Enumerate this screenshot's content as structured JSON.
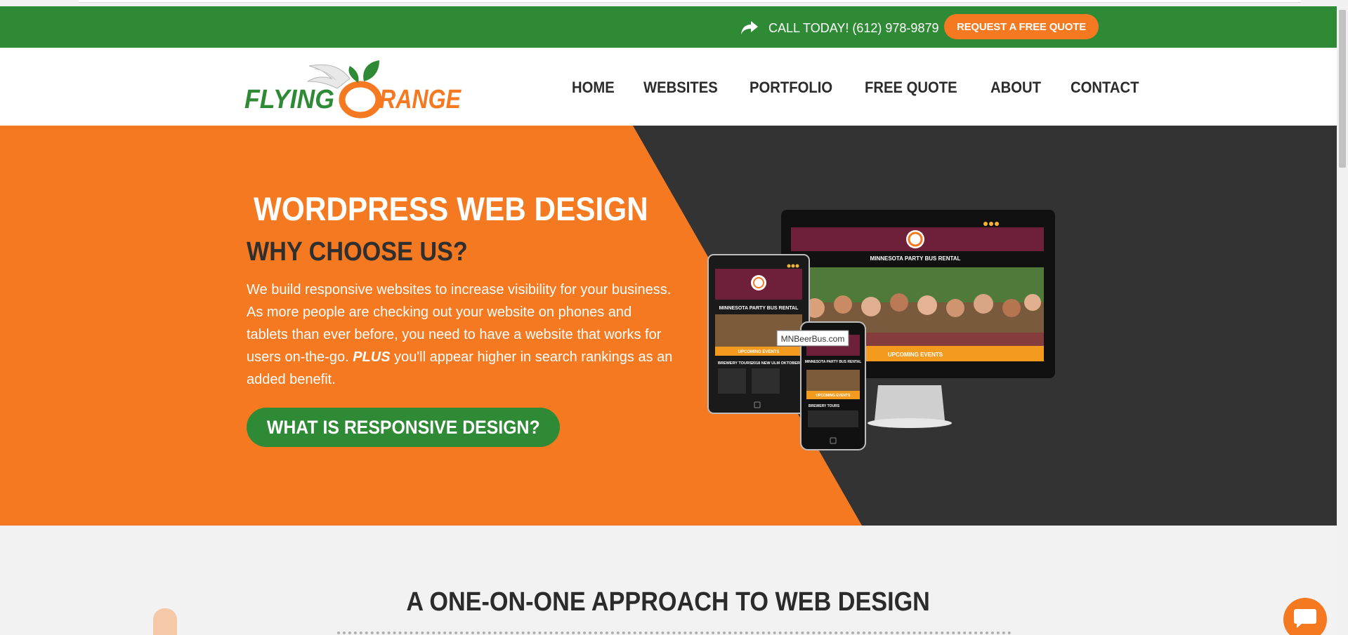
{
  "topbar": {
    "call_text": "CALL TODAY! (612) 978-9879",
    "quote_button": "REQUEST A FREE QUOTE"
  },
  "header": {
    "logo_text": "FLYING ORANGE",
    "nav": [
      "HOME",
      "WEBSITES",
      "PORTFOLIO",
      "FREE QUOTE",
      "ABOUT",
      "CONTACT"
    ]
  },
  "hero": {
    "title": "WORDPRESS WEB DESIGN",
    "subtitle": "WHY CHOOSE US?",
    "text_before": "We build responsive websites to increase visibility for your business. As more people are checking out your website on phones and tablets than ever before, you need to have a website that works for users on-the-go. ",
    "text_emphasis": "PLUS",
    "text_after": " you'll appear higher in search rankings as an added benefit.",
    "button": "WHAT IS RESPONSIVE DESIGN?",
    "mockup": {
      "site_title": "MINNESOTA PARTY BUS RENTAL",
      "events_label": "UPCOMING EVENTS",
      "tooltip": "MNBeerBus.com",
      "tablet_items": [
        "BREWERY TOURS",
        "2018 NEW ULM OKTOBERFEST"
      ],
      "phone_item": "BREWERY TOURS"
    }
  },
  "section2": {
    "title": "A ONE-ON-ONE APPROACH TO WEB DESIGN"
  },
  "colors": {
    "green": "#2f8a36",
    "orange": "#f47920",
    "dark": "#333333"
  }
}
